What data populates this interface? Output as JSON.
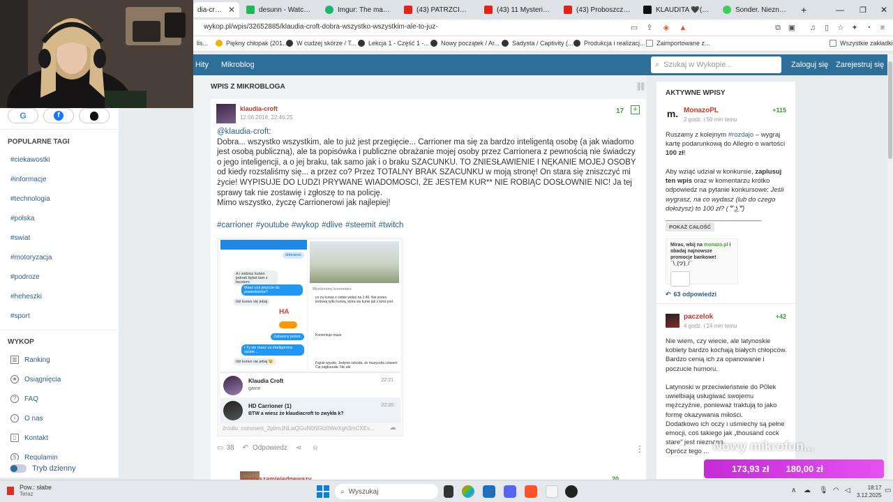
{
  "browser": {
    "tabs": [
      {
        "title": "dia-croft: D",
        "active": true,
        "color": "#2c6f9b"
      },
      {
        "title": "desunn - Watch clips o",
        "color": "#1db954"
      },
      {
        "title": "Imgur: The magic of th",
        "color": "#1bb76e"
      },
      {
        "title": "(43) PATRZCIE JAK JA T",
        "color": "#e62117"
      },
      {
        "title": "(43) 11 Mysterious Vid",
        "color": "#e62117"
      },
      {
        "title": "(43) Proboszcz kulfon",
        "color": "#e62117"
      },
      {
        "title": "KLAUDITA 🖤(@klauc",
        "color": "#111111"
      },
      {
        "title": "Sonder. Nieznane hist",
        "color": "#3ecf5a"
      }
    ],
    "new_tab": "+",
    "url": "wykop.pl/wpis/32652885/klaudia-croft-dobra-wszystko-wszystkim-ale-to-juz-",
    "bookmarks": [
      {
        "label": "lis...",
        "color": "#999999"
      },
      {
        "label": "Piękny chłopak (201...",
        "color": "#f0b400"
      },
      {
        "label": "W cudzej skórze / T...",
        "color": "#333333"
      },
      {
        "label": "Lekcja 1 - Część 1 -...",
        "color": "#333333"
      },
      {
        "label": "Nowy początek / Ar...",
        "color": "#333333"
      },
      {
        "label": "Sadysta / Captivity (...",
        "color": "#333333"
      },
      {
        "label": "Produkcja i realizacj...",
        "color": "#333333"
      },
      {
        "label": "Zaimportowane z...",
        "color": "#888888"
      }
    ],
    "all_bookmarks": "Wszystkie zakładki"
  },
  "site": {
    "nav": {
      "hity": "Hity",
      "mikroblog": "Mikroblog"
    },
    "search_placeholder": "Szukaj w Wykopie...",
    "login": "Zaloguj się",
    "register": "Zarejestruj się"
  },
  "sidebar": {
    "social": [
      "G",
      "f",
      ""
    ],
    "popular_heading": "POPULARNE TAGI",
    "tags": [
      "#ciekawostki",
      "#informacje",
      "#technologia",
      "#polska",
      "#swiat",
      "#motoryzacja",
      "#podroze",
      "#heheszki",
      "#sport"
    ],
    "wykop_heading": "WYKOP",
    "menu": [
      "Ranking",
      "Osiągnięcia",
      "FAQ",
      "O nas",
      "Kontakt",
      "Regulamin"
    ],
    "dark_mode": "Tryb dzienny"
  },
  "main": {
    "section_title": "WPIS Z MIKROBLOGA",
    "post": {
      "author": "klaudia-croft",
      "date": "12.06.2018, 22:46:25",
      "votes": "17",
      "mention": "@klaudia-croft",
      "mention_suffix": ":",
      "paragraphs": [
        "Dobra... wszystko wszystkim, ale to już jest przegięcie... Carrioner ma się za bardzo inteligentą osobę (a jak wiadomo jest osobą publiczną), ale ta popisówka i publiczne obrażanie mojej osoby przez Carrionera z pewnością nie świadczy o jego inteligencji, a o jej braku, tak samo jak i o braku SZACUNKU. TO ZNIESŁAWIENIE I NĘKANIE MOJEJ OSOBY od kiedy rozstaliśmy się... a przez co? Przez TOTALNY BRAK SZACUNKU w moją stronę! On stara się zniszczyć mi życie! WYPISUJE DO LUDZI PRYWANE WIADOMOSCI, ŻE JESTEM KUR** NIE ROBIĄC DOSŁOWNIE NIC! Ja tej sprawy tak nie zostawię i zgłoszę to na policję.",
        "Mimo wszystko, życzę Carrionerowi jak najlepiej!"
      ],
      "tags": [
        "#carrioner",
        "#youtube",
        "#wykop",
        "#dlive",
        "#steemit",
        "#twitch"
      ],
      "embed": {
        "msgs_right": [
          "dobranoc",
          "Masz coś jeszcze do powiedzenia?",
          "Zabawny jesteś.",
          "I Ty sie masz za inteligentna osobe..."
        ],
        "msgs_left": [
          "A i widzisz kurwo jednak byłaś tam z facetem.",
          "Idź kurwo się jebaj",
          "Idź kurwo się jebaj 😉"
        ],
        "comments_heading": "Wyróżniony komentarz",
        "comment_1": "co za kurwa z ciebie widać na 1:46. Nie jesteś królową tylko kurwą, która się kurwi jak z kimś jest.",
        "comment_2": "Komentuje mase",
        "comment_3": "Fajnie wyszło. Jedynie szkoda, że muzyczka czasem Cię zagłuszała. Nic ale",
        "chat1_name": "Klaudia Croft",
        "chat1_msg": "game",
        "chat1_time": "22:21",
        "chat2_name": "HD Carrioner (1)",
        "chat2_msg": "BTW a wiesz że klaudiacroft to zwykła k?",
        "chat2_time": "22:20"
      },
      "source": "źródło: comment_2pbmJNLwQGuN0NGtz0WeXgh3mCXEs...",
      "comments_count": "38",
      "reply": "Odpowiedz",
      "next_comment_author": "mogleszamiejednewazy",
      "next_comment_votes": "20"
    }
  },
  "right": {
    "heading": "AKTYWNE WPISY",
    "entries": [
      {
        "author": "MonazoPL",
        "time": "2 godz. i 50 min temu",
        "score": "+115",
        "text_1": "Ruszamy z kolejnym ",
        "tag": "#rozdajo",
        "text_2": " – wygraj kartę podarunkową do Allegro o wartości ",
        "bold": "100 zł",
        "text_3": "!",
        "text_4": "Aby wziąć udział w konkursie, ",
        "bold_2": "zaplusuj ten wpis",
        "text_5": " oraz w komentarzu krótko odpowiedz na pytanie konkursowe:",
        "italic": "Jeśli wygrasz, na co wydasz (lub do czego dołożysz) to 100 zł? ( ͡° ͜ʖ ͡°)",
        "divider": "__________________________",
        "show_all": "POKAŻ CAŁOŚĆ",
        "promo_1": "Miras, wbij na ",
        "promo_green": "monazo.pl",
        "promo_2": " i obadaj najnowsze promocje bankowe! ¯\\_(ツ)_/¯",
        "replies": "63 odpowiedzi"
      },
      {
        "author": "paczelok",
        "time": "4 godz. i 24 min temu",
        "score": "+42",
        "text": "Nie wiem, czy wiecie, ale latynoskie kobiety bardzo kochają białych chłopców.\nBardzo cenią ich za opanowanie i poczucie humoru.\n\nLatynoski w przeciwieństwie do P0lek uwielbiają usługiwać swojemu mężczyźnie, ponieważ traktują to jako formę okazywania miłości.\nDodatkowo ich oczy i uśmiechy są pełne emocji, coś takiego jak „thousand cock stare” jest nieznane.\nOprócz tego ..."
      }
    ]
  },
  "overlay": {
    "mic": "Nowy mikrofon...",
    "amount_1": "173,93 zł",
    "amount_2": "180,00 zł"
  },
  "taskbar": {
    "weather_title": "Pow.: słabe",
    "weather_sub": "Teraz",
    "search": "Wyszukaj",
    "time": "18:17",
    "date": "3.12.2025"
  }
}
